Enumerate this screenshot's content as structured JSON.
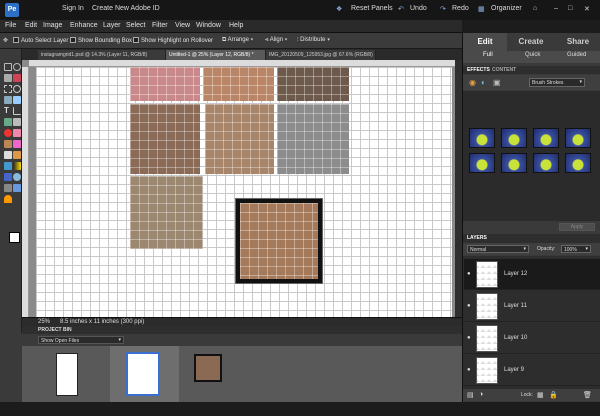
{
  "topbar": {
    "sign_in": "Sign In",
    "create_id": "Create New Adobe ID",
    "reset_panels": "Reset Panels",
    "undo": "Undo",
    "redo": "Redo",
    "organizer": "Organizer"
  },
  "menu": [
    "File",
    "Edit",
    "Image",
    "Enhance",
    "Layer",
    "Select",
    "Filter",
    "View",
    "Window",
    "Help"
  ],
  "options": {
    "auto_select": "Auto Select Layer",
    "bounding_box": "Show Bounding Box",
    "highlight": "Show Highlight on Rollover",
    "arrange": "Arrange",
    "align": "Align",
    "distribute": "Distribute"
  },
  "doc_tabs": [
    "instagramgrid1.psd @ 14.3% (Layer 11, RGB/8)",
    "Untitled-1 @ 25% (Layer 12, RGB/8) *",
    "IMG_20120509_125953.jpg @ 67.6% (RGB/8)"
  ],
  "status": {
    "zoom": "25%",
    "doc_size": "8.5 inches x 11 inches (300 ppi)"
  },
  "project_bin": {
    "title": "PROJECT BIN",
    "show": "Show Open Files"
  },
  "panel": {
    "tabs": [
      "Edit",
      "Create",
      "Share"
    ],
    "subtabs": [
      "Full",
      "Quick",
      "Guided"
    ],
    "effects_tab": "EFFECTS",
    "content_tab": "CONTENT",
    "effect_category": "Brush Strokes",
    "apply": "Apply",
    "layers_title": "LAYERS",
    "blend_mode": "Normal",
    "opacity_label": "Opacity:",
    "opacity_value": "100%",
    "lock_label": "Lock:",
    "layers": [
      "Layer 12",
      "Layer 11",
      "Layer 10",
      "Layer 9"
    ]
  },
  "colors": {
    "accent": "#3a6fd0",
    "panel_bg": "#3a3a3a",
    "canvas_bg": "#8a8a8a"
  }
}
